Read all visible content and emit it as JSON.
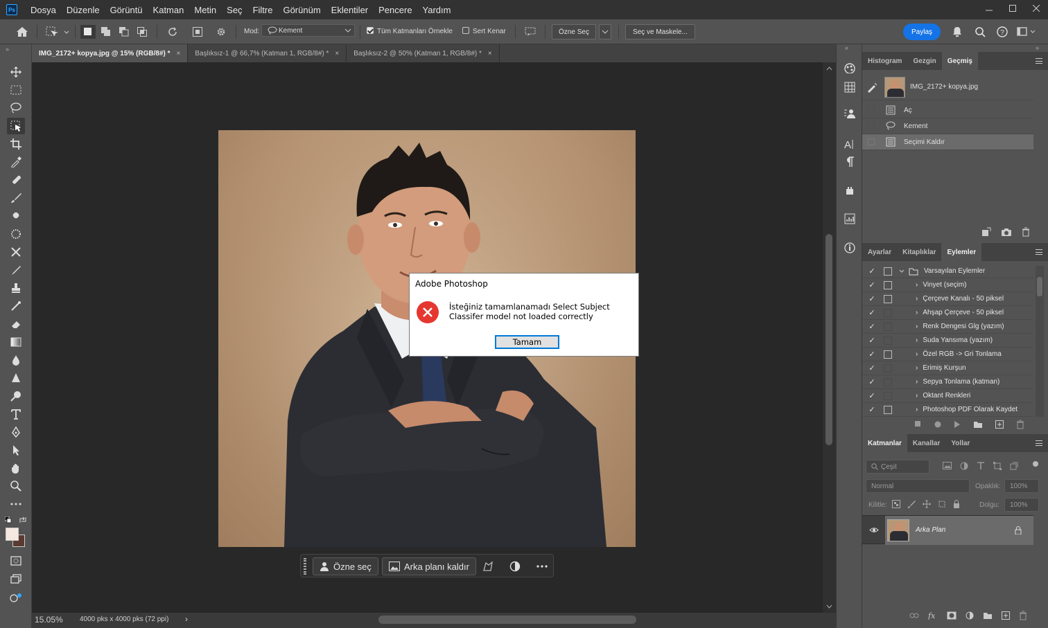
{
  "menubar": {
    "logo": "Ps",
    "items": [
      "Dosya",
      "Düzenle",
      "Görüntü",
      "Katman",
      "Metin",
      "Seç",
      "Filtre",
      "Görünüm",
      "Eklentiler",
      "Pencere",
      "Yardım"
    ]
  },
  "options": {
    "mode_label": "Mod:",
    "mode_value": "Kement",
    "sample_all_layers": "Tüm Katmanları Örnekle",
    "hard_edge": "Sert Kenar",
    "select_subject": "Özne Seç",
    "select_and_mask": "Seç ve Maskele...",
    "share": "Paylaş"
  },
  "tabs": [
    {
      "label": "IMG_2172+ kopya.jpg @ 15% (RGB/8#) *",
      "close": "×"
    },
    {
      "label": "Başlıksız-1 @ 66,7% (Katman 1, RGB/8#) *",
      "close": "×"
    },
    {
      "label": "Başlıksız-2 @ 50% (Katman 1, RGB/8#) *",
      "close": "×"
    }
  ],
  "status": {
    "zoom": "15.05%",
    "doc_info": "4000 pks x 4000 pks (72 ppi)",
    "arrow": "›"
  },
  "taskbar": {
    "select_subject": "Özne seç",
    "remove_bg": "Arka planı kaldır"
  },
  "dialog": {
    "title": "Adobe Photoshop",
    "message": "İsteğiniz tamamlanamadı Select Subject Classifer model not loaded correctly",
    "ok": "Tamam"
  },
  "history_panel": {
    "tabs": [
      "Histogram",
      "Gezgin",
      "Geçmiş"
    ],
    "snapshot": "IMG_2172+ kopya.jpg",
    "items": [
      "Aç",
      "Kement",
      "Seçimi Kaldır"
    ]
  },
  "actions_panel": {
    "tabs": [
      "Ayarlar",
      "Kitaplıklar",
      "Eylemler"
    ],
    "set_name": "Varsayılan Eylemler",
    "items": [
      "Vinyet (seçim)",
      "Çerçeve Kanalı - 50 piksel",
      "Ahşap Çerçeve - 50 piksel",
      "Renk Dengesi Glg (yazım)",
      "Suda Yansıma (yazım)",
      "Özel RGB -> Gri Tonlama",
      "Erimiş Kurşun",
      "Sepya Tonlama (katman)",
      "Oktant Renkleri",
      "Photoshop PDF Olarak Kaydet"
    ]
  },
  "layers_panel": {
    "tabs": [
      "Katmanlar",
      "Kanallar",
      "Yollar"
    ],
    "filter_placeholder": "Çeşit",
    "blend_mode": "Normal",
    "opacity_label": "Opaklık:",
    "opacity_value": "100%",
    "lock_label": "Kilitle:",
    "fill_label": "Dolgu:",
    "fill_value": "100%",
    "layer_name": "Arka Plan"
  },
  "colors": {
    "accent": "#1473e6",
    "error": "#e5372f",
    "foreground": "#f5e8e0",
    "background": "#5a3a30"
  }
}
